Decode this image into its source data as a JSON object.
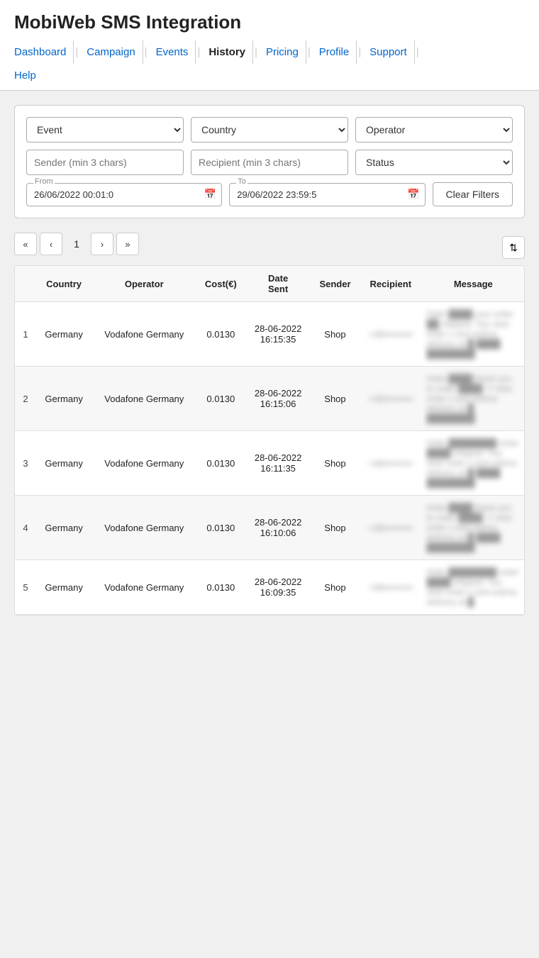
{
  "header": {
    "title": "MobiWeb SMS Integration",
    "nav": [
      {
        "label": "Dashboard",
        "active": false
      },
      {
        "label": "Campaign",
        "active": false
      },
      {
        "label": "Events",
        "active": false
      },
      {
        "label": "History",
        "active": true
      },
      {
        "label": "Pricing",
        "active": false
      },
      {
        "label": "Profile",
        "active": false
      },
      {
        "label": "Support",
        "active": false
      }
    ],
    "help_label": "Help"
  },
  "filters": {
    "event_placeholder": "Event",
    "country_placeholder": "Country",
    "operator_placeholder": "Operator",
    "sender_placeholder": "Sender (min 3 chars)",
    "recipient_placeholder": "Recipient (min 3 chars)",
    "status_placeholder": "Status",
    "from_label": "From",
    "to_label": "To",
    "from_value": "26/06/2022 00:01:0",
    "to_value": "29/06/2022 23:59:5",
    "clear_filters_label": "Clear Filters"
  },
  "pagination": {
    "first_label": "«",
    "prev_label": "‹",
    "page": "1",
    "next_label": "›",
    "last_label": "»"
  },
  "table": {
    "columns": [
      "",
      "Country",
      "Operator",
      "Cost(€)",
      "Date Sent",
      "Sender",
      "Recipient",
      "Message"
    ],
    "rows": [
      {
        "num": "1",
        "country": "Germany",
        "operator": "Vodafone Germany",
        "cost": "0.0130",
        "date_sent": "28-06-2022 16:15:35",
        "sender": "Shop",
        "recipient": "••••••••••",
        "message": "Hello ████ your order ██ shipped. You view order s and estima delivery at █ ████ ████████"
      },
      {
        "num": "2",
        "country": "Germany",
        "operator": "Vodafone Germany",
        "cost": "0.0130",
        "date_sent": "28-06-2022 16:15:06",
        "sender": "Shop",
        "recipient": "••••••••••",
        "message": "Hello ████ thank you fo order ████. Y view order s and estima delivery at █ ████████"
      },
      {
        "num": "3",
        "country": "Germany",
        "operator": "Vodafone Germany",
        "cost": "0.0130",
        "date_sent": "28-06-2022 16:11:35",
        "sender": "Shop",
        "recipient": "••••••••••",
        "message": "Hello ████████ order ████ shipped. You view order s and estima delivery at █ ████ ████████"
      },
      {
        "num": "4",
        "country": "Germany",
        "operator": "Vodafone Germany",
        "cost": "0.0130",
        "date_sent": "28-06-2022 16:10:06",
        "sender": "Shop",
        "recipient": "••••••••••",
        "message": "Hello ████ thank you fo order ████. Y view order s and estima delivery at █ ████ ████████"
      },
      {
        "num": "5",
        "country": "Germany",
        "operator": "Vodafone Germany",
        "cost": "0.0130",
        "date_sent": "28-06-2022 16:09:35",
        "sender": "Shop",
        "recipient": "••••••••••",
        "message": "Hello ████████ order ████ shipped. You view order s and estima delivery at █"
      }
    ]
  }
}
